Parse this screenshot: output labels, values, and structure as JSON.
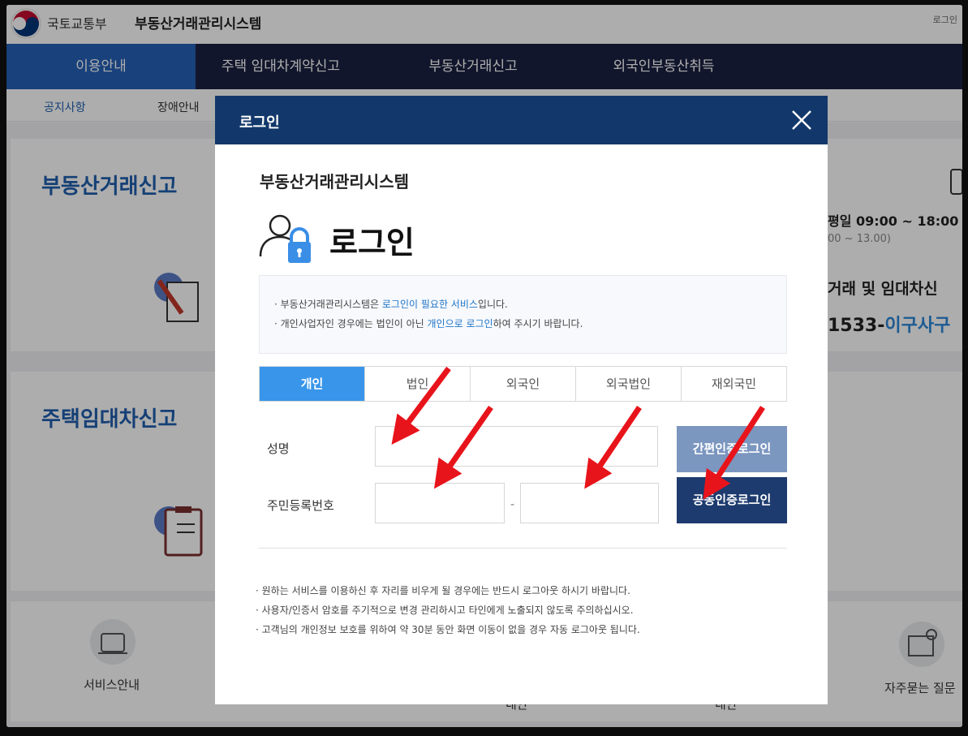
{
  "header": {
    "ministry": "국토교통부",
    "system_title": "부동산거래관리시스템",
    "top_login": "로그인"
  },
  "gnb": [
    {
      "label": "이용안내"
    },
    {
      "label": "주택 임대차계약신고"
    },
    {
      "label": "부동산거래신고"
    },
    {
      "label": "외국인부동산취득"
    }
  ],
  "subnav": [
    "공지사항",
    "장애안내"
  ],
  "background": {
    "card1_title": "부동산거래신고",
    "card2_title": "주택임대차신고",
    "hours": "평일 09:00 ~ 18:00",
    "lunch": "00 ~ 13.00)",
    "contact_title": "거래 및 임대차신",
    "phone_prefix": "1533-",
    "phone_suffix": "이구사구",
    "service_label": "서비스안내",
    "faq_label": "자주묻는 질문",
    "partial_1": "내안",
    "partial_2": "내안"
  },
  "modal": {
    "title": "로그인",
    "system_name": "부동산거래관리시스템",
    "login_heading": "로그인",
    "notice": [
      {
        "pre": "· 부동산거래관리시스템은 ",
        "hl": "로그인이 필요한 서비스",
        "post": "입니다."
      },
      {
        "pre": "· 개인사업자인 경우에는 법인이 아닌 ",
        "hl": "개인으로 로그인",
        "post": "하여 주시기 바랍니다."
      }
    ],
    "tabs": [
      {
        "label": "개인",
        "active": true
      },
      {
        "label": "법인",
        "active": false
      },
      {
        "label": "외국인",
        "active": false
      },
      {
        "label": "외국법인",
        "active": false
      },
      {
        "label": "재외국민",
        "active": false
      }
    ],
    "name_label": "성명",
    "rrn_label": "주민등록번호",
    "rrn_separator": "-",
    "easy_login_button": "간편인증로그인",
    "cert_login_button": "공동인증로그인",
    "footer_notes": [
      "· 원하는 서비스를 이용하신 후 자리를 비우게 될 경우에는 반드시 로그아웃 하시기 바랍니다.",
      "· 사용자/인증서 암호를 주기적으로 변경 관리하시고 타인에게 노출되지 않도록 주의하십시오.",
      "· 고객님의 개인정보 보호를 위하여 약 30분 동안 화면 이동이 없을 경우 자동 로그아웃 됩니다."
    ]
  },
  "colors": {
    "gnb": "#1b2142",
    "gnb_active": "#2560b6",
    "modal_header": "#12386b",
    "tab_active": "#3895ea",
    "easy_button": "#7b96bf",
    "cert_button": "#1e3b6f",
    "arrow": "#e8141b"
  }
}
